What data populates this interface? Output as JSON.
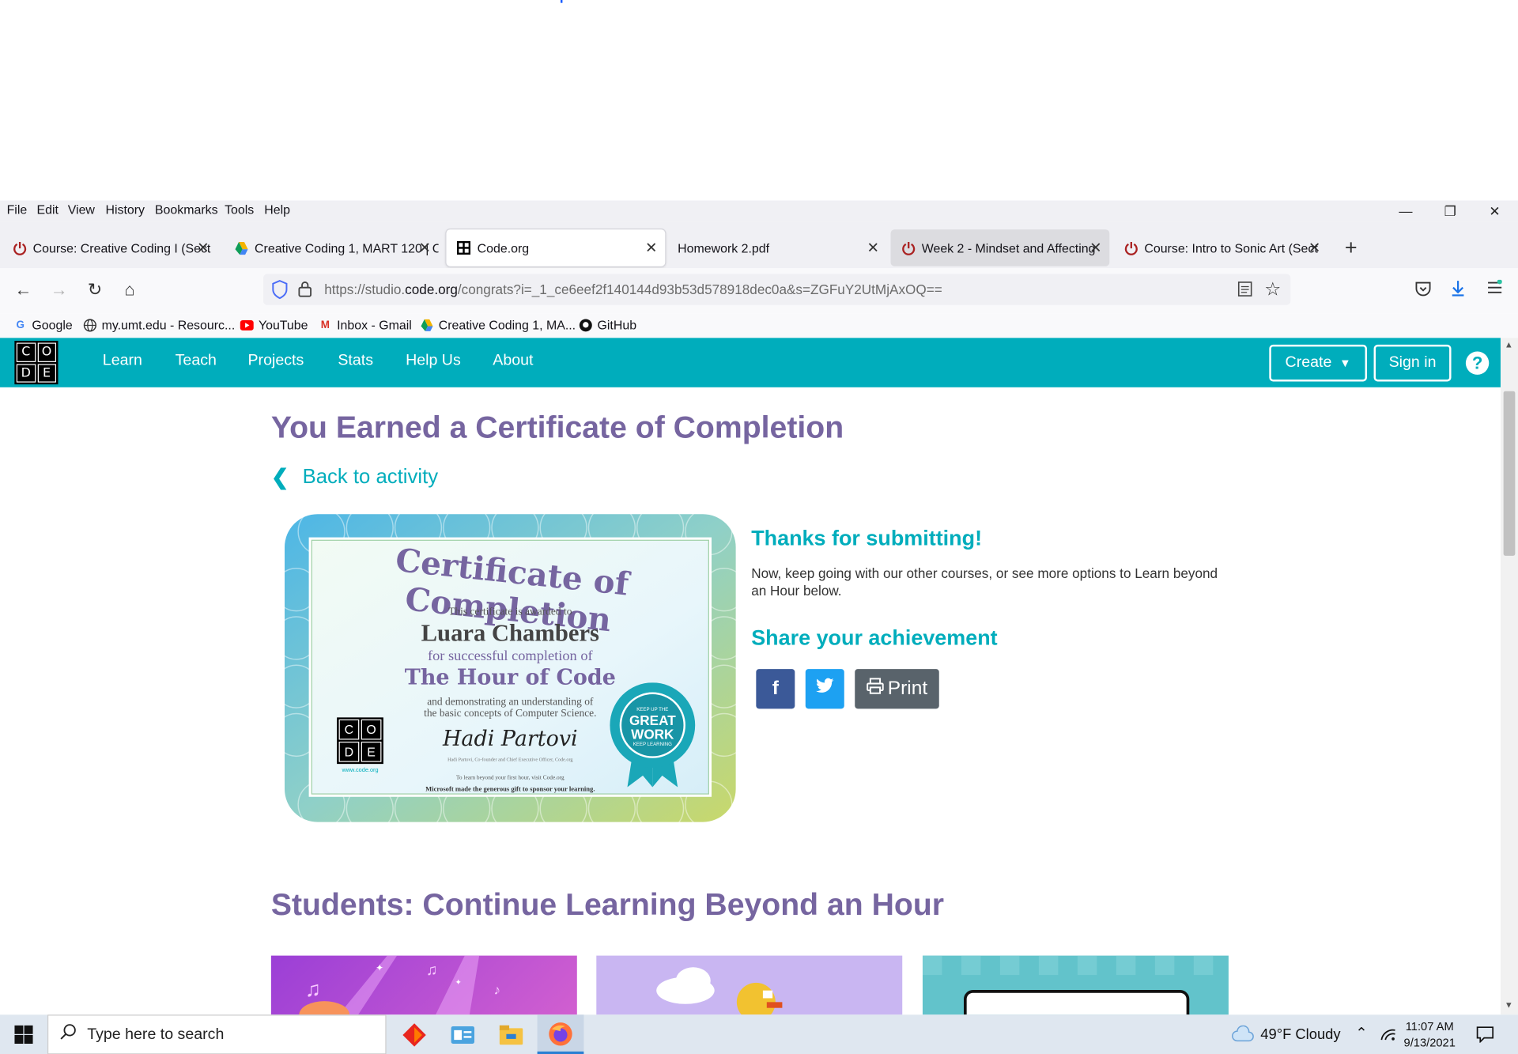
{
  "menubar": {
    "items": [
      "File",
      "Edit",
      "View",
      "History",
      "Bookmarks",
      "Tools",
      "Help"
    ]
  },
  "tabs": [
    {
      "title": "Course: Creative Coding I (Sect",
      "icon": "power-icon"
    },
    {
      "title": "Creative Coding 1, MART 120 | C",
      "icon": "drive-icon"
    },
    {
      "title": "Code.org",
      "icon": "codeorg-icon"
    },
    {
      "title": "Homework 2.pdf",
      "icon": "pdf-icon"
    },
    {
      "title": "Week 2 - Mindset and Affecting",
      "icon": "power-icon"
    },
    {
      "title": "Course: Intro to Sonic Art (Sect",
      "icon": "power-icon"
    }
  ],
  "address": {
    "prefix": "https://studio.",
    "domain": "code.org",
    "path": "/congrats?i=_1_ce6eef2f140144d93b53d578918dec0a&s=ZGFuY2UtMjAxOQ=="
  },
  "bookmarks": [
    "Google",
    "my.umt.edu - Resourc...",
    "YouTube",
    "Inbox - Gmail",
    "Creative Coding 1, MA...",
    "GitHub"
  ],
  "site": {
    "logo_letters": [
      "C",
      "O",
      "D",
      "E"
    ],
    "nav": [
      "Learn",
      "Teach",
      "Projects",
      "Stats",
      "Help Us",
      "About"
    ],
    "create_label": "Create",
    "signin_label": "Sign in",
    "help_label": "?"
  },
  "main": {
    "title": "You Earned a Certificate of Completion",
    "back_label": "Back to activity",
    "certificate": {
      "heading": "Certificate of Completion",
      "awarded": "This certificate is awarded to",
      "name": "Luara Chambers",
      "for": "for successful completion of",
      "course": "The Hour of Code",
      "demo1": "and demonstrating an understanding of",
      "demo2": "the basic concepts of Computer Science.",
      "signature": "Hadi Partovi",
      "signer": "Hadi Partovi, Co-founder and Chief Executive Officer, Code.org",
      "url": "www.code.org",
      "footer1": "To learn beyond your first hour, visit Code.org",
      "footer2": "Microsoft made the generous gift to sponsor your learning.",
      "badge_top": "KEEP UP THE",
      "badge_main1": "GREAT",
      "badge_main2": "WORK",
      "badge_bottom": "KEEP LEARNING"
    },
    "thanks_title": "Thanks for submitting!",
    "thanks_text": "Now, keep going with our other courses, or see more options to Learn beyond an Hour below.",
    "share_title": "Share your achievement",
    "print_label": "Print",
    "continue_title": "Students: Continue Learning Beyond an Hour"
  },
  "taskbar": {
    "search_placeholder": "Type here to search",
    "weather": "49°F  Cloudy",
    "time": "11:07 AM",
    "date": "9/13/2021"
  },
  "colors": {
    "teal": "#00adbc",
    "purple": "#7665a0",
    "facebook": "#3b5998",
    "twitter": "#1da1f2",
    "print": "#59636b"
  }
}
